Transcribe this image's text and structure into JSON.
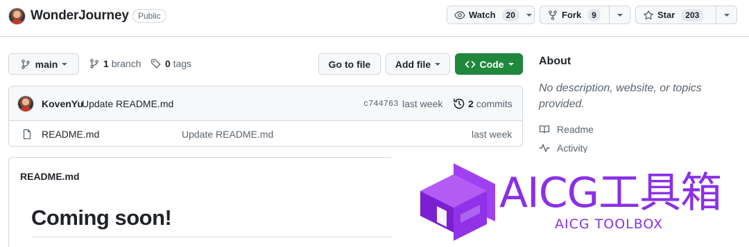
{
  "repo": {
    "name": "WonderJourney",
    "visibility": "Public"
  },
  "header": {
    "watch": {
      "label": "Watch",
      "count": "20"
    },
    "fork": {
      "label": "Fork",
      "count": "9"
    },
    "star": {
      "label": "Star",
      "count": "203"
    }
  },
  "branch_bar": {
    "current_branch": "main",
    "branches_count": "1",
    "branches_label": "branch",
    "tags_count": "0",
    "tags_label": "tags",
    "goto_file_label": "Go to file",
    "add_file_label": "Add file",
    "code_label": "Code"
  },
  "latest_commit": {
    "author": "KovenYu",
    "message": "Update README.md",
    "hash": "c744763",
    "time": "last week",
    "commits_count": "2",
    "commits_label": "commits"
  },
  "files": [
    {
      "name": "README.md",
      "commit_message": "Update README.md",
      "time": "last week"
    }
  ],
  "readme": {
    "title": "README.md",
    "heading": "Coming soon!"
  },
  "about": {
    "title": "About",
    "description": "No description, website, or topics provided.",
    "links": [
      {
        "label": "Readme",
        "icon": "book-icon"
      },
      {
        "label": "Activity",
        "icon": "pulse-icon"
      }
    ]
  },
  "watermark": {
    "title": "AICG工具箱",
    "subtitle": "AICG TOOLBOX"
  },
  "colors": {
    "code_button": "#1f883d",
    "watermark": "#8a30e6",
    "border": "#d0d7de",
    "muted_text": "#59636e"
  }
}
